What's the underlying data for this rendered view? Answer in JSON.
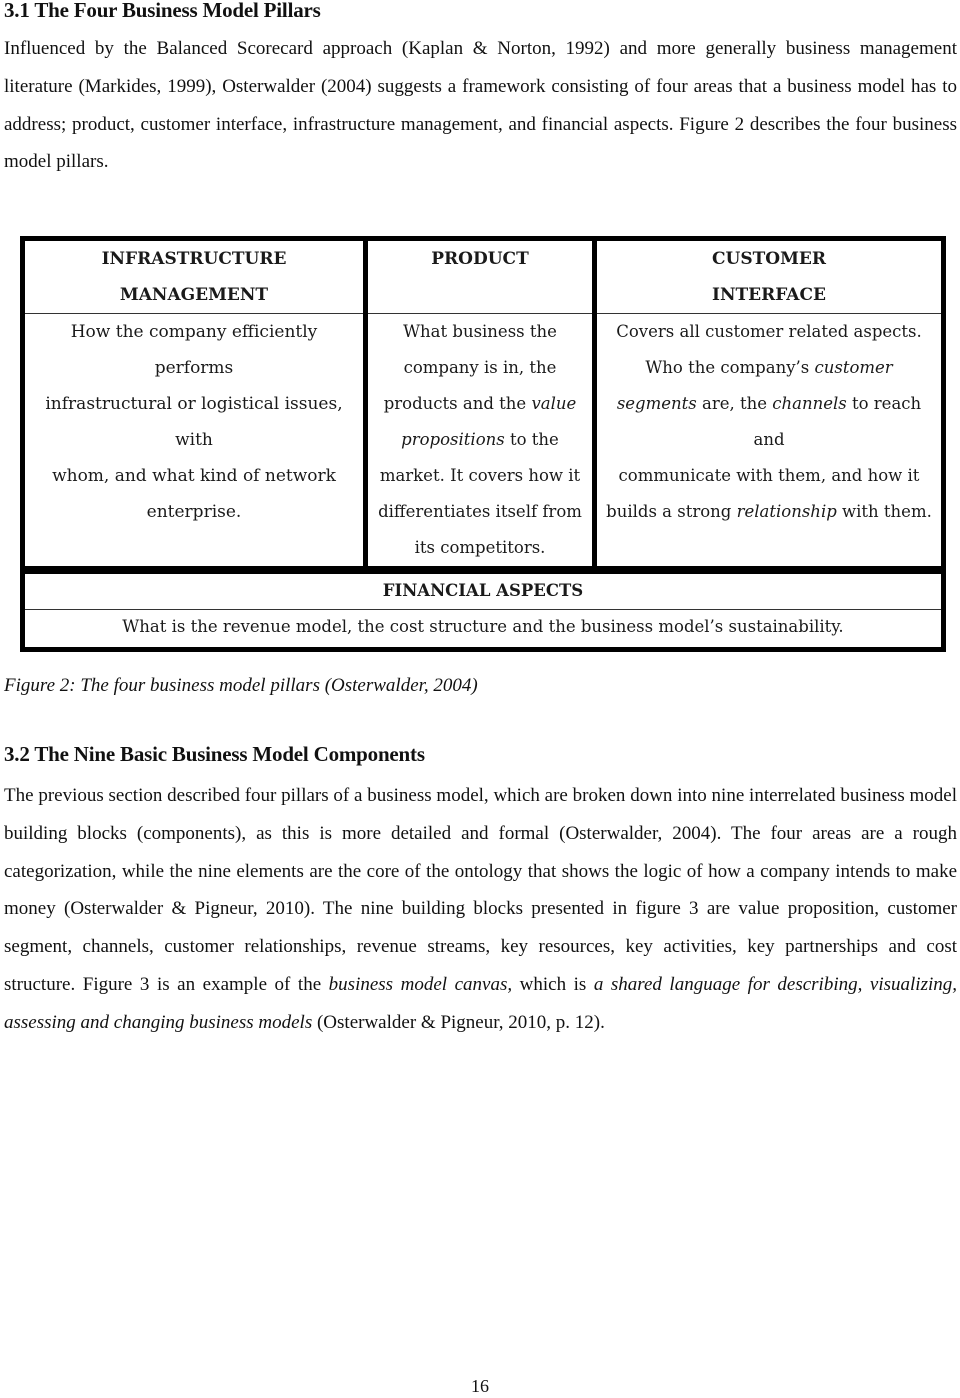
{
  "section1": {
    "heading": "3.1 The Four Business Model Pillars",
    "paragraph": "Influenced by the Balanced Scorecard approach  (Kaplan & Norton, 1992) and more generally business management literature (Markides, 1999), Osterwalder (2004) suggests a framework consisting of four areas that a business model has to address; product, customer interface, infrastructure management, and financial aspects. Figure 2 describes the four business model pillars."
  },
  "figure": {
    "pillars": [
      {
        "title_line1": "INFRASTRUCTURE",
        "title_line2": "MANAGEMENT",
        "lines": [
          "How the company efficiently performs",
          "infrastructural or logistical issues, with",
          "whom, and what kind of network",
          "enterprise."
        ]
      },
      {
        "title_line1": "PRODUCT",
        "title_line2": "",
        "lines": [
          {
            "pre": "What business the",
            "em": "",
            "post": ""
          },
          {
            "pre": "company is in, the",
            "em": "",
            "post": ""
          },
          {
            "pre": "products and the ",
            "em": "value",
            "post": ""
          },
          {
            "pre": "",
            "em": "propositions",
            "post": " to the"
          },
          {
            "pre": "market. It covers how it",
            "em": "",
            "post": ""
          },
          {
            "pre": "differentiates itself from",
            "em": "",
            "post": ""
          },
          {
            "pre": "its competitors.",
            "em": "",
            "post": ""
          }
        ]
      },
      {
        "title_line1": "CUSTOMER",
        "title_line2": "INTERFACE",
        "lines": [
          {
            "pre": "Covers all customer related aspects.",
            "em": "",
            "post": ""
          },
          {
            "pre": "Who the company’s ",
            "em": "customer",
            "post": ""
          },
          {
            "pre": "",
            "em": "segments",
            "post": " are, the ",
            "em2": "channels",
            "post2": " to reach and"
          },
          {
            "pre": "communicate with them, and how it",
            "em": "",
            "post": ""
          },
          {
            "pre": "builds a strong ",
            "em": "relationship",
            "post": " with them."
          }
        ]
      }
    ],
    "financial": {
      "title": "FINANCIAL ASPECTS",
      "text": "What is the revenue model, the cost structure and the business model’s sustainability."
    },
    "caption": "Figure 2: The four business model pillars (Osterwalder, 2004)"
  },
  "section2": {
    "heading": "3.2 The Nine Basic Business Model Components",
    "paragraph_part1": "The previous section described four pillars of a business model, which are broken down into nine interrelated business model building blocks (components), as this is more detailed and formal (Osterwalder, 2004). The four areas are a rough categorization, while the nine elements are the core of the ontology that shows the logic of how a company intends to make money (Osterwalder & Pigneur, 2010). The nine building blocks presented in figure 3 are value proposition, customer segment, channels, customer relationships, revenue streams, key resources, key activities, key partnerships and cost structure. Figure 3 is an example of the ",
    "paragraph_em1": "business model canvas,",
    "paragraph_part2": " which is ",
    "paragraph_em2": "a shared language for describing, visualizing, assessing and changing business models",
    "paragraph_part3": "  (Osterwalder & Pigneur, 2010, p. 12)."
  },
  "footer": {
    "page_number": "16"
  }
}
